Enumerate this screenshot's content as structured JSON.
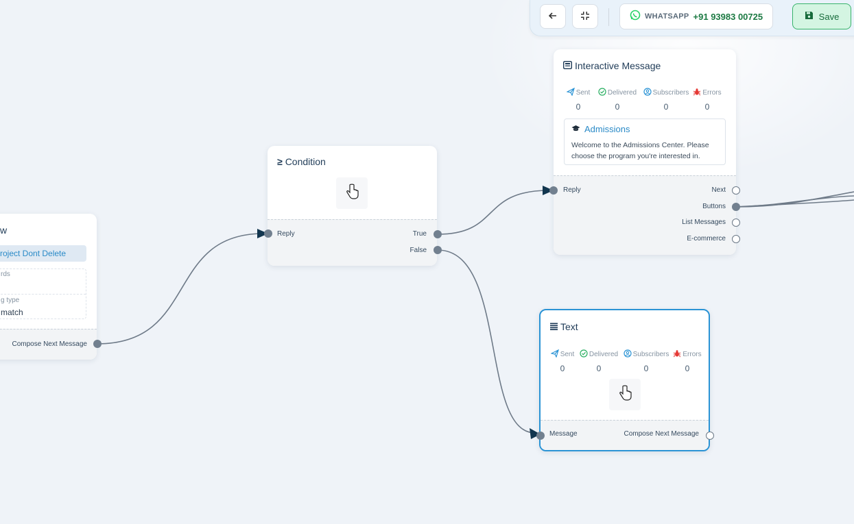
{
  "toolbar": {
    "channel_label": "WHATSAPP",
    "phone_number": "+91 93983 00725",
    "save_label": "Save"
  },
  "keyword_node": {
    "title_fragment": "w",
    "project_name": "roject Dont Delete",
    "keywords_label": "rds",
    "matching_type_label": "g type",
    "matching_type_value": "match",
    "output_label": "Compose Next Message"
  },
  "condition_node": {
    "title": "Condition",
    "input_label": "Reply",
    "true_label": "True",
    "false_label": "False"
  },
  "interactive_node": {
    "title": "Interactive Message",
    "stats": [
      {
        "label": "Sent",
        "value": "0"
      },
      {
        "label": "Delivered",
        "value": "0"
      },
      {
        "label": "Subscribers",
        "value": "0"
      },
      {
        "label": "Errors",
        "value": "0"
      }
    ],
    "message_title": "Admissions",
    "message_body": "Welcome to the Admissions Center. Please choose the program you're interested in.",
    "input_label": "Reply",
    "outputs": [
      "Next",
      "Buttons",
      "List Messages",
      "E-commerce"
    ]
  },
  "text_node": {
    "title": "Text",
    "stats": [
      {
        "label": "Sent",
        "value": "0"
      },
      {
        "label": "Delivered",
        "value": "0"
      },
      {
        "label": "Subscribers",
        "value": "0"
      },
      {
        "label": "Errors",
        "value": "0"
      }
    ],
    "input_label": "Message",
    "output_label": "Compose Next Message"
  },
  "colors": {
    "canvas": "#eff3f8",
    "edge": "#6e7a88",
    "arrow": "#12364f",
    "accent": "#2a93d5",
    "whatsapp": "#25d366",
    "save_bg": "#d4f5e2",
    "error_red": "#e53935"
  }
}
